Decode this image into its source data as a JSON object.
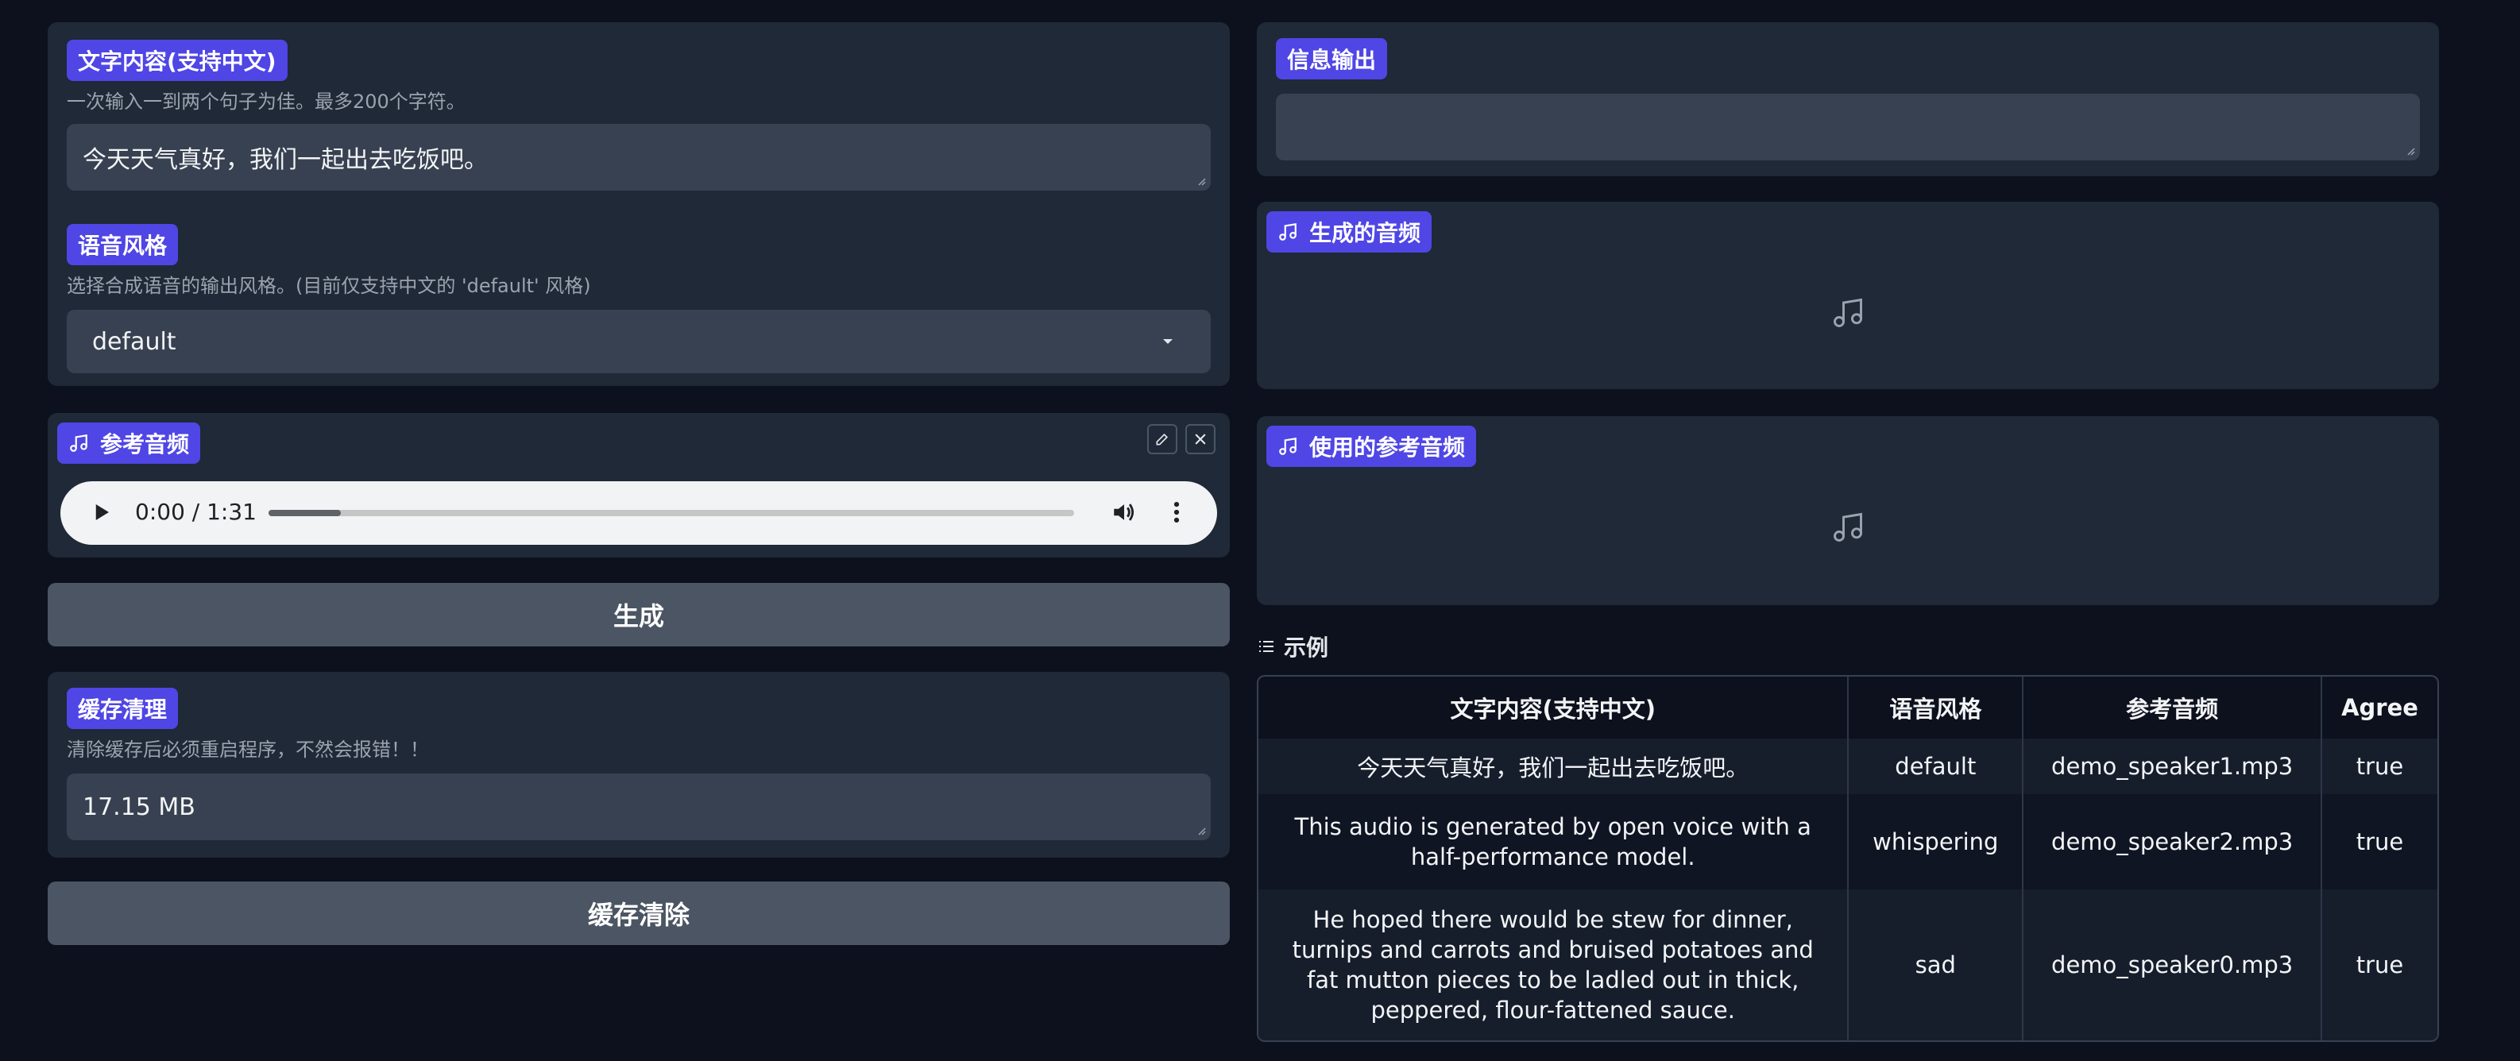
{
  "text_panel": {
    "label": "文字内容(支持中文)",
    "hint": "一次输入一到两个句子为佳。最多200个字符。",
    "value": "今天天气真好，我们一起出去吃饭吧。"
  },
  "style_panel": {
    "label": "语音风格",
    "hint": "选择合成语音的输出风格。(目前仅支持中文的 'default' 风格)",
    "selected": "default"
  },
  "ref_audio": {
    "label": "参考音频",
    "time": "0:00 / 1:31",
    "progress": 0.09
  },
  "generate_button": "生成",
  "cache": {
    "label": "缓存清理",
    "hint": "清除缓存后必须重启程序，不然会报错！！",
    "value": "17.15 MB",
    "clear_button": "缓存清除"
  },
  "info_output": {
    "label": "信息输出",
    "value": ""
  },
  "generated_audio": {
    "label": "生成的音频"
  },
  "used_ref_audio": {
    "label": "使用的参考音频"
  },
  "examples": {
    "title": "示例",
    "headers": [
      "文字内容(支持中文)",
      "语音风格",
      "参考音频",
      "Agree"
    ],
    "rows": [
      [
        "今天天气真好，我们一起出去吃饭吧。",
        "default",
        "demo_speaker1.mp3",
        "true"
      ],
      [
        "This audio is generated by open voice with a half-performance model.",
        "whispering",
        "demo_speaker2.mp3",
        "true"
      ],
      [
        "He hoped there would be stew for dinner, turnips and carrots and bruised potatoes and fat mutton pieces to be ladled out in thick, peppered, flour-fattened sauce.",
        "sad",
        "demo_speaker0.mp3",
        "true"
      ]
    ]
  },
  "colors": {
    "background": "#0c111d",
    "panel": "#1f2937",
    "field": "#374151",
    "accent": "#4f46e5",
    "button": "#4b5563"
  },
  "icons": [
    "music-note-icon",
    "pencil-icon",
    "close-icon",
    "play-icon",
    "volume-icon",
    "more-vertical-icon",
    "chevron-down-icon",
    "list-icon"
  ]
}
